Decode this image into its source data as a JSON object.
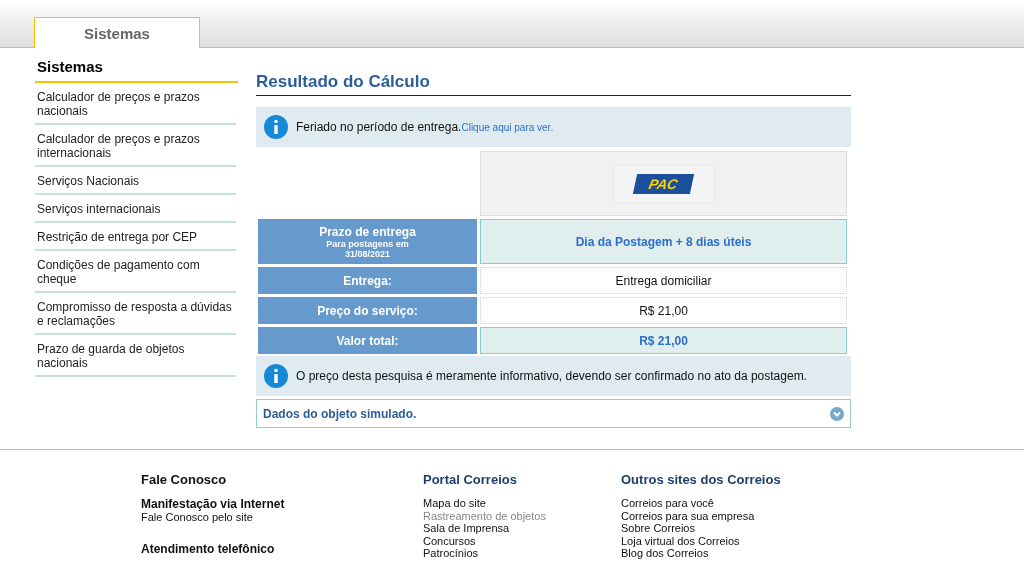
{
  "header": {
    "tabs": [
      {
        "label": "Sistemas",
        "selected": true
      }
    ]
  },
  "sidebar": {
    "title": "Sistemas",
    "items": [
      {
        "label": "Calculador de preços e prazos nacionais"
      },
      {
        "label": "Calculador de preços e prazos internacionais"
      },
      {
        "label": "Serviços Nacionais"
      },
      {
        "label": "Serviços internacionais"
      },
      {
        "label": "Restrição de entrega por CEP"
      },
      {
        "label": "Condições de pagamento com cheque"
      },
      {
        "label": "Compromisso de resposta a dúvidas e reclamações"
      },
      {
        "label": "Prazo de guarda de objetos nacionais"
      }
    ]
  },
  "main": {
    "title": "Resultado do Cálculo",
    "notice": {
      "text": "Feriado no período de entrega.",
      "link": "Clique aqui para ver."
    },
    "service_logo": "PAC",
    "rows": [
      {
        "label": "Prazo de entrega",
        "sublabel": "Para postagens em 31/08/2021",
        "value": "Dia da Postagem + 8 dias úteis",
        "highlight": true
      },
      {
        "label": "Entrega:",
        "value": "Entrega domiciliar",
        "highlight": false
      },
      {
        "label": "Preço do serviço:",
        "value": "R$ 21,00",
        "highlight": false
      },
      {
        "label": "Valor total:",
        "value": "R$ 21,00",
        "highlight": true
      }
    ],
    "disclaimer": "O preço desta pesquisa é meramente informativo, devendo ser confirmado no ato da postagem.",
    "accordion": {
      "label": "Dados do objeto simulado.",
      "expanded": false
    }
  },
  "footer": {
    "columns": [
      {
        "title": "Fale Conosco",
        "groups": [
          {
            "heading": "Manifestação via Internet",
            "links": [
              {
                "label": "Fale Conosco pelo site",
                "visited": false
              }
            ]
          },
          {
            "heading": "Atendimento telefônico"
          }
        ]
      },
      {
        "title": "Portal Correios",
        "groups": [
          {
            "links": [
              {
                "label": "Mapa do site",
                "visited": false
              },
              {
                "label": "Rastreamento de objetos",
                "visited": true
              },
              {
                "label": "Sala de Imprensa",
                "visited": false
              },
              {
                "label": "Concursos",
                "visited": false
              },
              {
                "label": "Patrocínios",
                "visited": false
              }
            ]
          }
        ]
      },
      {
        "title": "Outros sites dos Correios",
        "groups": [
          {
            "links": [
              {
                "label": "Correios para você",
                "visited": false
              },
              {
                "label": "Correios para sua empresa",
                "visited": false
              },
              {
                "label": "Sobre Correios",
                "visited": false
              },
              {
                "label": "Loja virtual dos Correios",
                "visited": false
              },
              {
                "label": "Blog dos Correios",
                "visited": false
              }
            ]
          }
        ]
      }
    ]
  }
}
